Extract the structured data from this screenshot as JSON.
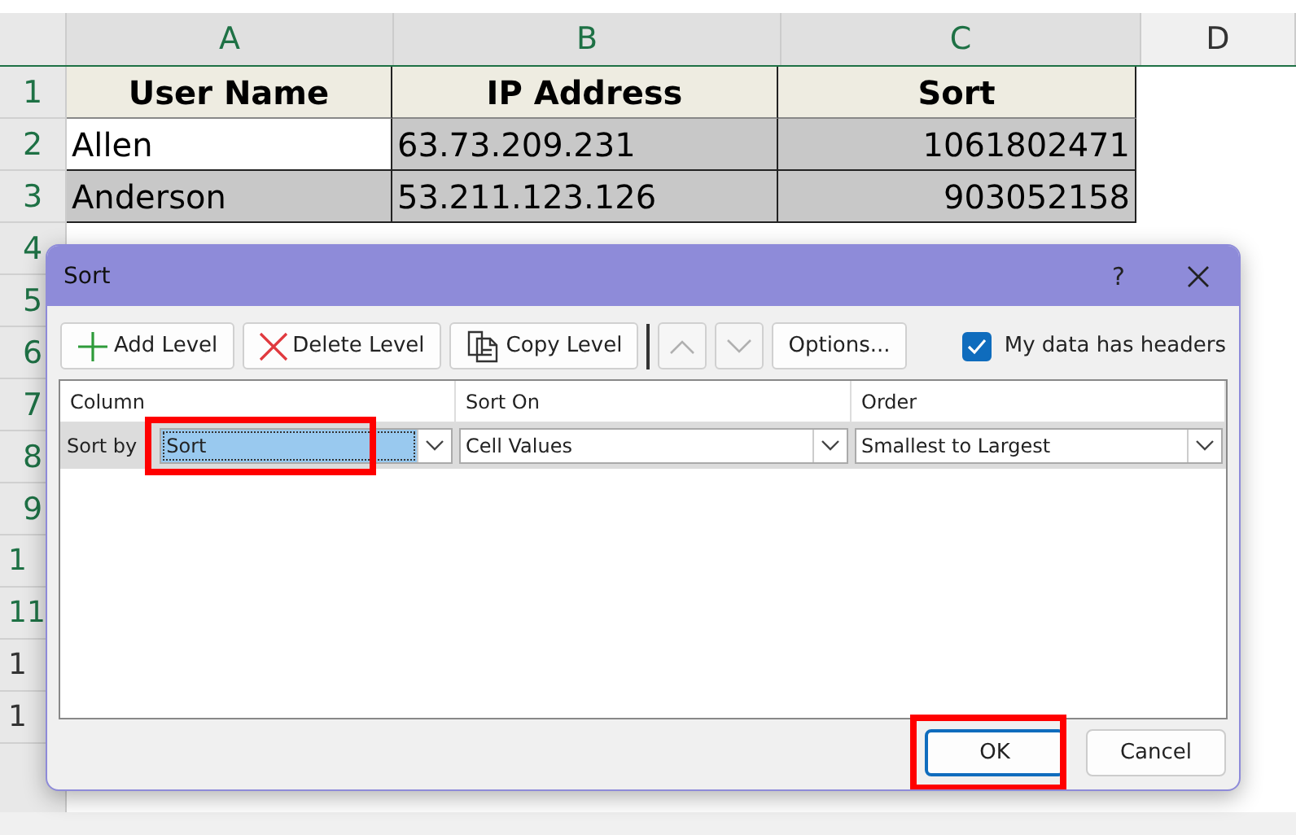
{
  "sheet": {
    "columns": [
      "A",
      "B",
      "C",
      "D"
    ],
    "row_numbers": [
      "1",
      "2",
      "3",
      "4",
      "5",
      "6",
      "7",
      "8",
      "9",
      "1",
      "11",
      "1",
      "1"
    ],
    "rows": [
      {
        "kind": "header",
        "cells": [
          {
            "text": "User Name"
          },
          {
            "text": "IP Address"
          },
          {
            "text": "Sort"
          }
        ]
      },
      {
        "kind": "data",
        "selected": true,
        "cells": [
          {
            "text": "Allen",
            "active": true
          },
          {
            "text": "63.73.209.231",
            "active": false
          },
          {
            "text": "1061802471",
            "active": false
          }
        ]
      },
      {
        "kind": "data",
        "selected": true,
        "cells": [
          {
            "text": "Anderson",
            "active": false
          },
          {
            "text": "53.211.123.126",
            "active": false
          },
          {
            "text": "903052158",
            "active": false
          }
        ]
      }
    ]
  },
  "dialog": {
    "title": "Sort",
    "help": "?",
    "toolbar": [
      {
        "kind": "add",
        "label": "Add Level",
        "disabled": false
      },
      {
        "kind": "delete",
        "label": "Delete Level",
        "disabled": false
      },
      {
        "kind": "copy",
        "label": "Copy Level",
        "disabled": false
      },
      {
        "kind": "up",
        "disabled": true
      },
      {
        "kind": "down",
        "disabled": true
      },
      {
        "kind": "options",
        "label": "Options...",
        "disabled": false
      }
    ],
    "headers_checkbox": {
      "label": "My data has headers",
      "checked": true
    },
    "grid_columns": [
      "Column",
      "Sort On",
      "Order"
    ],
    "levels": [
      {
        "label": "Sort by",
        "column": "Sort",
        "sort_on": "Cell Values",
        "order": "Smallest to Largest",
        "selected": true,
        "column_highlighted": true
      }
    ],
    "buttons": [
      {
        "label": "OK",
        "default": true,
        "highlighted": true
      },
      {
        "label": "Cancel",
        "default": false,
        "highlighted": false
      }
    ]
  }
}
